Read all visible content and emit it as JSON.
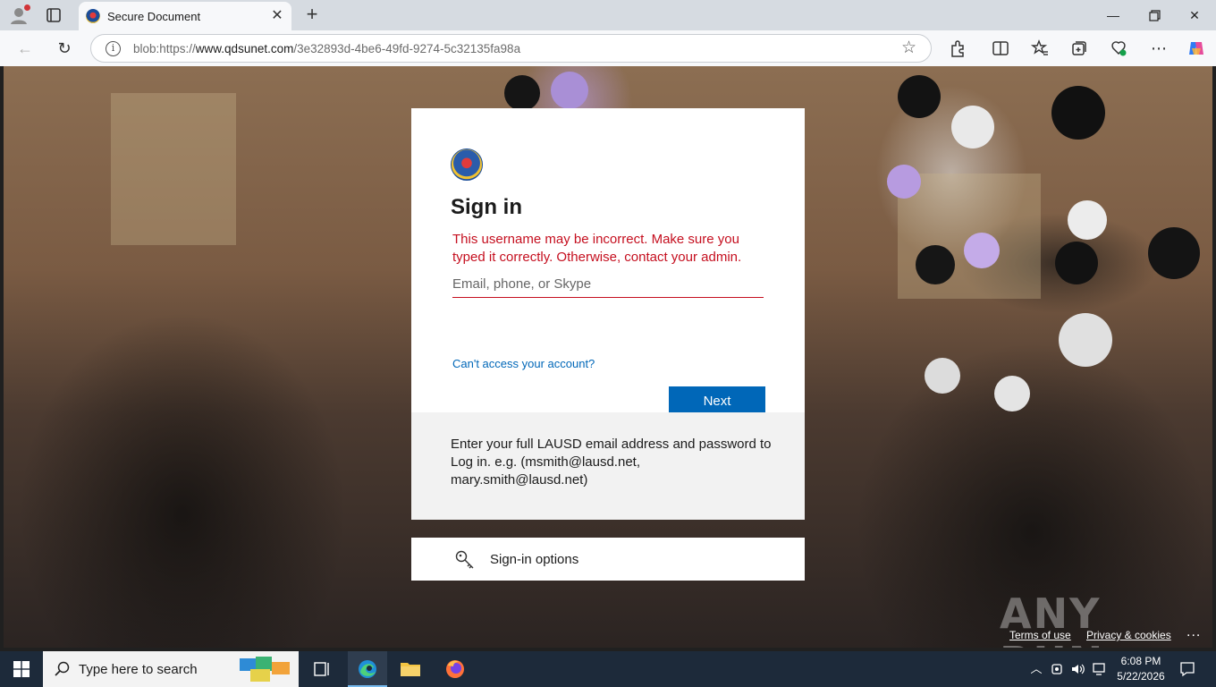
{
  "browser": {
    "tab_title": "Secure Document",
    "url_prefix": "blob:https://",
    "url_host": "www.qdsunet.com",
    "url_path": "/3e32893d-4be6-49fd-9274-5c32135fa98a"
  },
  "signin": {
    "title": "Sign in",
    "error": "This username may be incorrect. Make sure you typed it correctly. Otherwise, contact your admin.",
    "input_placeholder": "Email, phone, or Skype",
    "input_value": "",
    "cant_access": "Can't access your account?",
    "next_label": "Next",
    "footer": "Enter your full LAUSD email address and password to Log in. e.g. (msmith@lausd.net, mary.smith@lausd.net)",
    "options_label": "Sign-in options"
  },
  "page_footer": {
    "terms": "Terms of use",
    "privacy": "Privacy & cookies",
    "more": "..."
  },
  "watermark": "ANY  RUN",
  "taskbar": {
    "search_placeholder": "Type here to search",
    "time": "6:08 PM",
    "date": "5/22/2026"
  },
  "colors": {
    "accent": "#0067b8",
    "error": "#c50f1f",
    "taskbar": "#1d2a3a"
  }
}
